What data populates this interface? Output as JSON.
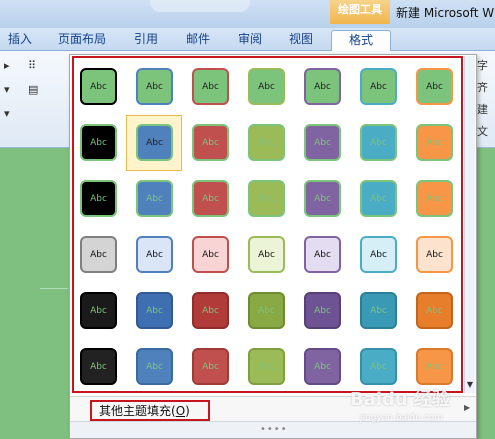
{
  "window": {
    "contextual_tab_group": "绘图工具",
    "doc_title": "新建 Microsoft W"
  },
  "tabs": [
    {
      "label": "插入"
    },
    {
      "label": "页面布局"
    },
    {
      "label": "引用"
    },
    {
      "label": "邮件"
    },
    {
      "label": "审阅"
    },
    {
      "label": "视图"
    },
    {
      "label": "格式"
    }
  ],
  "ribbon_right_text": [
    "字",
    "齐",
    "建",
    "文"
  ],
  "gallery": {
    "swatch_label": "Abc",
    "selected_index": 8,
    "swatches": [
      {
        "bg": "#7cc37c",
        "bd": "#000000",
        "tx": "#222222"
      },
      {
        "bg": "#7cc37c",
        "bd": "#4f81bd",
        "tx": "#222222"
      },
      {
        "bg": "#7cc37c",
        "bd": "#c0504d",
        "tx": "#222222"
      },
      {
        "bg": "#7cc37c",
        "bd": "#9bbb59",
        "tx": "#222222"
      },
      {
        "bg": "#7cc37c",
        "bd": "#8064a2",
        "tx": "#222222"
      },
      {
        "bg": "#7cc37c",
        "bd": "#4bacc6",
        "tx": "#222222"
      },
      {
        "bg": "#7cc37c",
        "bd": "#f79646",
        "tx": "#222222"
      },
      {
        "bg": "#000000",
        "bd": "#7cc37c",
        "tx": "#7cc37c"
      },
      {
        "bg": "#4f81bd",
        "bd": "#7cc37c",
        "tx": "#222222"
      },
      {
        "bg": "#c0504d",
        "bd": "#7cc37c",
        "tx": "#7cc37c"
      },
      {
        "bg": "#9bbb59",
        "bd": "#7cc37c",
        "tx": "#7cc37c"
      },
      {
        "bg": "#8064a2",
        "bd": "#7cc37c",
        "tx": "#7cc37c"
      },
      {
        "bg": "#4bacc6",
        "bd": "#7cc37c",
        "tx": "#7cc37c"
      },
      {
        "bg": "#f79646",
        "bd": "#7cc37c",
        "tx": "#7cc37c"
      },
      {
        "bg": "#000000",
        "bd": "#7cc37c",
        "tx": "#7cc37c"
      },
      {
        "bg": "#4f81bd",
        "bd": "#7cc37c",
        "tx": "#7cc37c"
      },
      {
        "bg": "#c0504d",
        "bd": "#7cc37c",
        "tx": "#7cc37c"
      },
      {
        "bg": "#9bbb59",
        "bd": "#7cc37c",
        "tx": "#7cc37c"
      },
      {
        "bg": "#8064a2",
        "bd": "#7cc37c",
        "tx": "#7cc37c"
      },
      {
        "bg": "#4bacc6",
        "bd": "#7cc37c",
        "tx": "#7cc37c"
      },
      {
        "bg": "#f79646",
        "bd": "#7cc37c",
        "tx": "#7cc37c"
      },
      {
        "bg": "#d4d4d4",
        "bd": "#7f7f7f",
        "tx": "#111111"
      },
      {
        "bg": "#dbe5f8",
        "bd": "#4f81bd",
        "tx": "#111111"
      },
      {
        "bg": "#f8d5d4",
        "bd": "#c0504d",
        "tx": "#111111"
      },
      {
        "bg": "#ebf4d6",
        "bd": "#9bbb59",
        "tx": "#111111"
      },
      {
        "bg": "#e4dcf0",
        "bd": "#8064a2",
        "tx": "#111111"
      },
      {
        "bg": "#d6eef6",
        "bd": "#4bacc6",
        "tx": "#111111"
      },
      {
        "bg": "#fde3cd",
        "bd": "#f79646",
        "tx": "#111111"
      },
      {
        "bg": "#1a1a1a",
        "bd": "#000000",
        "tx": "#7cc37c"
      },
      {
        "bg": "#3e6fb0",
        "bd": "#2f5a94",
        "tx": "#7cc37c"
      },
      {
        "bg": "#b13b38",
        "bd": "#912d2a",
        "tx": "#7cc37c"
      },
      {
        "bg": "#89a944",
        "bd": "#6f8c32",
        "tx": "#7cc37c"
      },
      {
        "bg": "#6e5394",
        "bd": "#574077",
        "tx": "#7cc37c"
      },
      {
        "bg": "#3a9ab5",
        "bd": "#2b7f96",
        "tx": "#7cc37c"
      },
      {
        "bg": "#e67e2c",
        "bd": "#c4651c",
        "tx": "#7cc37c"
      },
      {
        "bg": "#222222",
        "bd": "#000000",
        "tx": "#7cc37c"
      },
      {
        "bg": "#4f81bd",
        "bd": "#3a6aa3",
        "tx": "#7cc37c"
      },
      {
        "bg": "#c0504d",
        "bd": "#a03a37",
        "tx": "#7cc37c"
      },
      {
        "bg": "#9bbb59",
        "bd": "#7f9f40",
        "tx": "#7cc37c"
      },
      {
        "bg": "#8064a2",
        "bd": "#654b86",
        "tx": "#7cc37c"
      },
      {
        "bg": "#4bacc6",
        "bd": "#3591aa",
        "tx": "#7cc37c"
      },
      {
        "bg": "#f79646",
        "bd": "#d97a2c",
        "tx": "#7cc37c"
      }
    ],
    "more_fills_label_prefix": "其他主题填充(",
    "more_fills_label_key": "O",
    "more_fills_label_suffix": ")"
  },
  "watermark": {
    "brand": "Baidu 经验",
    "url": "jingyan.baidu.com"
  },
  "colors": {
    "highlight_frame": "#c8141e",
    "contextual_tab": "#f0b54b",
    "page_background": "#7fbf7f"
  }
}
